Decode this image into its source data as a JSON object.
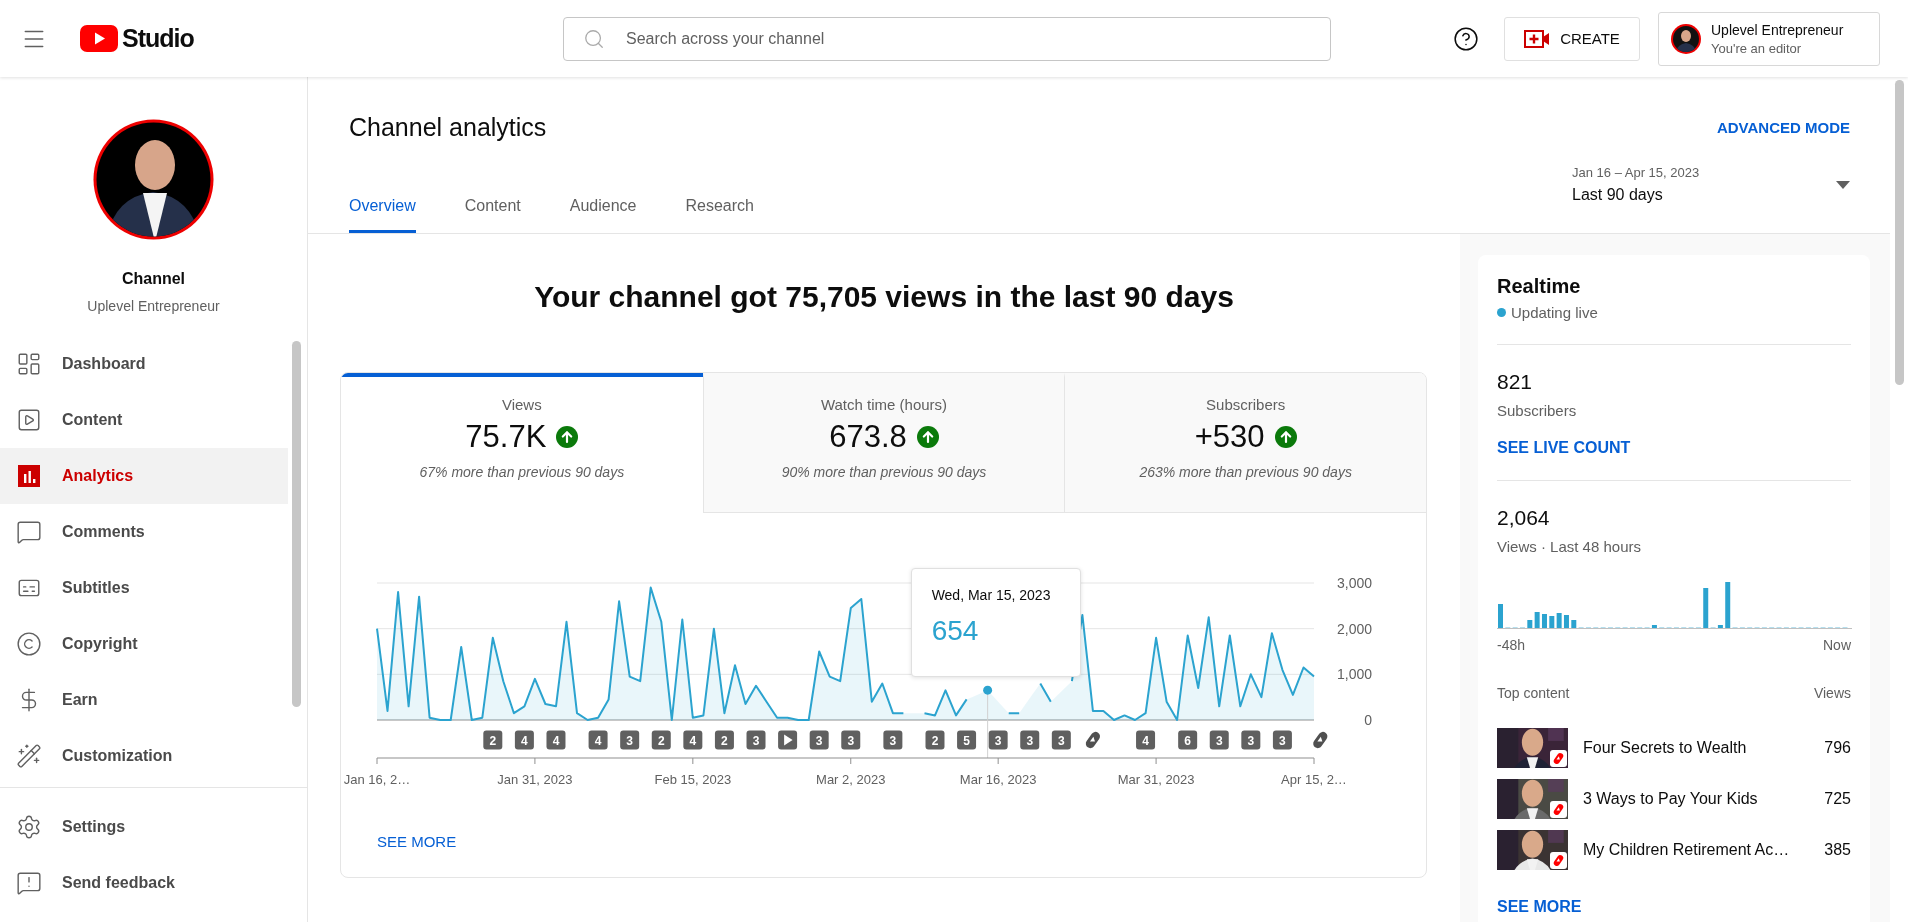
{
  "header": {
    "logo_text": "Studio",
    "search": {
      "placeholder": "Search across your channel"
    },
    "create_button": "CREATE",
    "account": {
      "name": "Uplevel Entrepreneur",
      "role": "You're an editor"
    }
  },
  "sidebar": {
    "channel": {
      "title": "Channel",
      "name": "Uplevel Entrepreneur"
    },
    "items": [
      {
        "kind": "dashboard",
        "label": "Dashboard",
        "selected": false
      },
      {
        "kind": "content",
        "label": "Content",
        "selected": false
      },
      {
        "kind": "analytics",
        "label": "Analytics",
        "selected": true
      },
      {
        "kind": "comments",
        "label": "Comments",
        "selected": false
      },
      {
        "kind": "subtitles",
        "label": "Subtitles",
        "selected": false
      },
      {
        "kind": "copyright",
        "label": "Copyright",
        "selected": false
      },
      {
        "kind": "earn",
        "label": "Earn",
        "selected": false
      },
      {
        "kind": "customization",
        "label": "Customization",
        "selected": false
      }
    ],
    "footer_items": [
      {
        "kind": "settings",
        "label": "Settings"
      },
      {
        "kind": "feedback",
        "label": "Send feedback"
      }
    ]
  },
  "page": {
    "title": "Channel analytics",
    "advanced_mode": "ADVANCED MODE",
    "tabs": [
      {
        "label": "Overview",
        "selected": true
      },
      {
        "label": "Content",
        "selected": false
      },
      {
        "label": "Audience",
        "selected": false
      },
      {
        "label": "Research",
        "selected": false
      }
    ],
    "date_range": {
      "range": "Jan 16 – Apr 15, 2023",
      "preset": "Last 90 days"
    }
  },
  "summary": {
    "headline": "Your channel got 75,705 views in the last 90 days",
    "metrics": [
      {
        "label": "Views",
        "value": "75.7K",
        "rising": true,
        "note": "67% more than previous 90 days",
        "selected": true
      },
      {
        "label": "Watch time (hours)",
        "value": "673.8",
        "rising": true,
        "note": "90% more than previous 90 days",
        "selected": false
      },
      {
        "label": "Subscribers",
        "value": "+530",
        "rising": true,
        "note": "263% more than previous 90 days",
        "selected": false
      }
    ],
    "chart_data": {
      "type": "area",
      "ylim": [
        0,
        3000
      ],
      "categories": [
        "Jan 16, 2…",
        null,
        null,
        null,
        null,
        null,
        null,
        null,
        null,
        null,
        null,
        null,
        null,
        null,
        null,
        "Jan 31, 2023",
        null,
        null,
        null,
        null,
        null,
        null,
        null,
        null,
        null,
        null,
        null,
        null,
        null,
        null,
        "Feb 15, 2023",
        null,
        null,
        null,
        null,
        null,
        null,
        null,
        null,
        null,
        null,
        null,
        null,
        null,
        null,
        "Mar 2, 2023",
        null,
        null,
        null,
        null,
        null,
        null,
        null,
        null,
        null,
        null,
        null,
        null,
        null,
        "Mar 16, 2023",
        null,
        null,
        null,
        null,
        null,
        null,
        null,
        null,
        null,
        null,
        null,
        null,
        null,
        null,
        "Mar 31, 2023",
        null,
        null,
        null,
        null,
        null,
        null,
        null,
        null,
        null,
        null,
        null,
        null,
        null,
        null,
        "Apr 15, 2…"
      ],
      "series": [
        {
          "color": "#2ba3cf",
          "values": [
            2000,
            200,
            2800,
            300,
            2700,
            50,
            0,
            0,
            1600,
            0,
            50,
            1800,
            850,
            150,
            300,
            900,
            350,
            300,
            2150,
            150,
            0,
            50,
            450,
            2600,
            950,
            850,
            2900,
            2150,
            0,
            2200,
            50,
            100,
            2000,
            150,
            1200,
            350,
            750,
            400,
            50,
            50,
            0,
            0,
            1500,
            950,
            850,
            2450,
            2650,
            400,
            800,
            150,
            150,
            null,
            150,
            100,
            650,
            100,
            450,
            null,
            650,
            null,
            150,
            150,
            null,
            800,
            400,
            null,
            850,
            2300,
            200,
            200,
            0,
            100,
            0,
            150,
            1800,
            400,
            0,
            1850,
            700,
            2250,
            300,
            1850,
            300,
            1000,
            500,
            1900,
            1100,
            550,
            1150,
            950
          ]
        }
      ],
      "yticks": [
        {
          "value": 0,
          "label": "0"
        },
        {
          "value": 1000,
          "label": "1,000"
        },
        {
          "value": 2000,
          "label": "2,000"
        },
        {
          "value": 3000,
          "label": "3,000"
        }
      ]
    },
    "tooltip": {
      "date": "Wed, Mar 15, 2023",
      "value": "654"
    },
    "markers": [
      {
        "kind": "count",
        "label": "2"
      },
      {
        "kind": "count",
        "label": "4"
      },
      {
        "kind": "count",
        "label": "4"
      },
      {
        "kind": "count",
        "label": "4"
      },
      {
        "kind": "count",
        "label": "3"
      },
      {
        "kind": "count",
        "label": "2"
      },
      {
        "kind": "count",
        "label": "4"
      },
      {
        "kind": "count",
        "label": "2"
      },
      {
        "kind": "count",
        "label": "3"
      },
      {
        "kind": "play"
      },
      {
        "kind": "count",
        "label": "3"
      },
      {
        "kind": "count",
        "label": "3"
      },
      {
        "kind": "count",
        "label": "3"
      },
      {
        "kind": "count",
        "label": "2"
      },
      {
        "kind": "count",
        "label": "5"
      },
      {
        "kind": "count",
        "label": "3"
      },
      {
        "kind": "count",
        "label": "3"
      },
      {
        "kind": "count",
        "label": "3"
      },
      {
        "kind": "shorts"
      },
      {
        "kind": "count",
        "label": "4"
      },
      {
        "kind": "count",
        "label": "6"
      },
      {
        "kind": "count",
        "label": "3"
      },
      {
        "kind": "count",
        "label": "3"
      },
      {
        "kind": "count",
        "label": "3"
      },
      {
        "kind": "shorts"
      }
    ],
    "see_more": "SEE MORE"
  },
  "realtime": {
    "title": "Realtime",
    "status": "Updating live",
    "subscribers": {
      "value": "821",
      "label": "Subscribers",
      "link": "SEE LIVE COUNT"
    },
    "views": {
      "value": "2,064",
      "label": "Views · Last 48 hours",
      "axis_start": "-48h",
      "axis_end": "Now"
    },
    "top_content": {
      "title": "Top content",
      "views_header": "Views",
      "items": [
        {
          "title": "Four Secrets to Wealth",
          "views": "796"
        },
        {
          "title": "3 Ways to Pay Your Kids",
          "views": "725"
        },
        {
          "title": "My Children Retirement Ac…",
          "views": "385"
        }
      ]
    },
    "see_more": "SEE MORE"
  }
}
